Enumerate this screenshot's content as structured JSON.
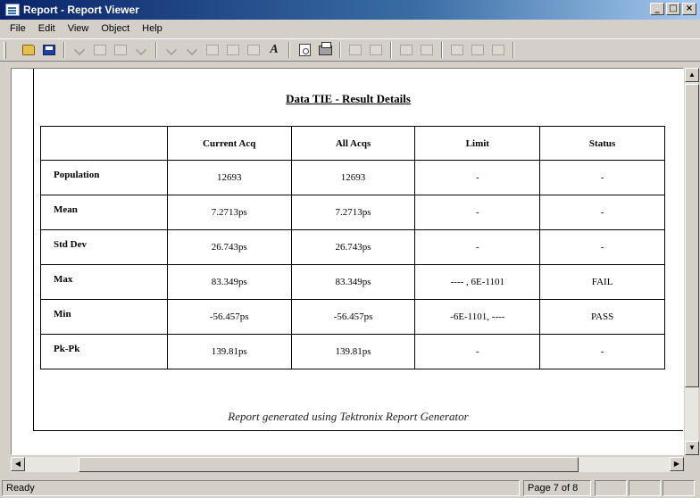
{
  "window": {
    "title": "Report - Report Viewer",
    "controls": [
      "minimize",
      "maximize",
      "close"
    ]
  },
  "menu": {
    "items": [
      "File",
      "Edit",
      "View",
      "Object",
      "Help"
    ]
  },
  "toolbar": {
    "icons": [
      "open-icon",
      "save-icon",
      "cut-icon",
      "copy-icon",
      "paste-icon",
      "undo-icon",
      "link-icon",
      "unlink-icon",
      "insert-table-icon",
      "insert-row-icon",
      "insert-column-icon",
      "text-tool-icon",
      "print-preview-icon",
      "print-icon",
      "align-left-icon",
      "align-center-icon",
      "align-right-icon",
      "justify-icon",
      "grid-icon",
      "chart-icon",
      "export-icon"
    ]
  },
  "report": {
    "title": "Data TIE - Result Details",
    "columns": [
      "",
      "Current Acq",
      "All Acqs",
      "Limit",
      "Status"
    ],
    "rows": [
      {
        "label": "Population",
        "current": "12693",
        "all": "12693",
        "limit": "-",
        "status": "-"
      },
      {
        "label": "Mean",
        "current": "7.2713ps",
        "all": "7.2713ps",
        "limit": "-",
        "status": "-"
      },
      {
        "label": "Std Dev",
        "current": "26.743ps",
        "all": "26.743ps",
        "limit": "-",
        "status": "-"
      },
      {
        "label": "Max",
        "current": "83.349ps",
        "all": "83.349ps",
        "limit": "---- , 6E-1101",
        "status": "FAIL"
      },
      {
        "label": "Min",
        "current": "-56.457ps",
        "all": "-56.457ps",
        "limit": "-6E-1101, ----",
        "status": "PASS"
      },
      {
        "label": "Pk-Pk",
        "current": "139.81ps",
        "all": "139.81ps",
        "limit": "-",
        "status": "-"
      }
    ],
    "footer": "Report generated using Tektronix Report Generator"
  },
  "status": {
    "left": "Ready",
    "page": "Page 7 of 8"
  }
}
